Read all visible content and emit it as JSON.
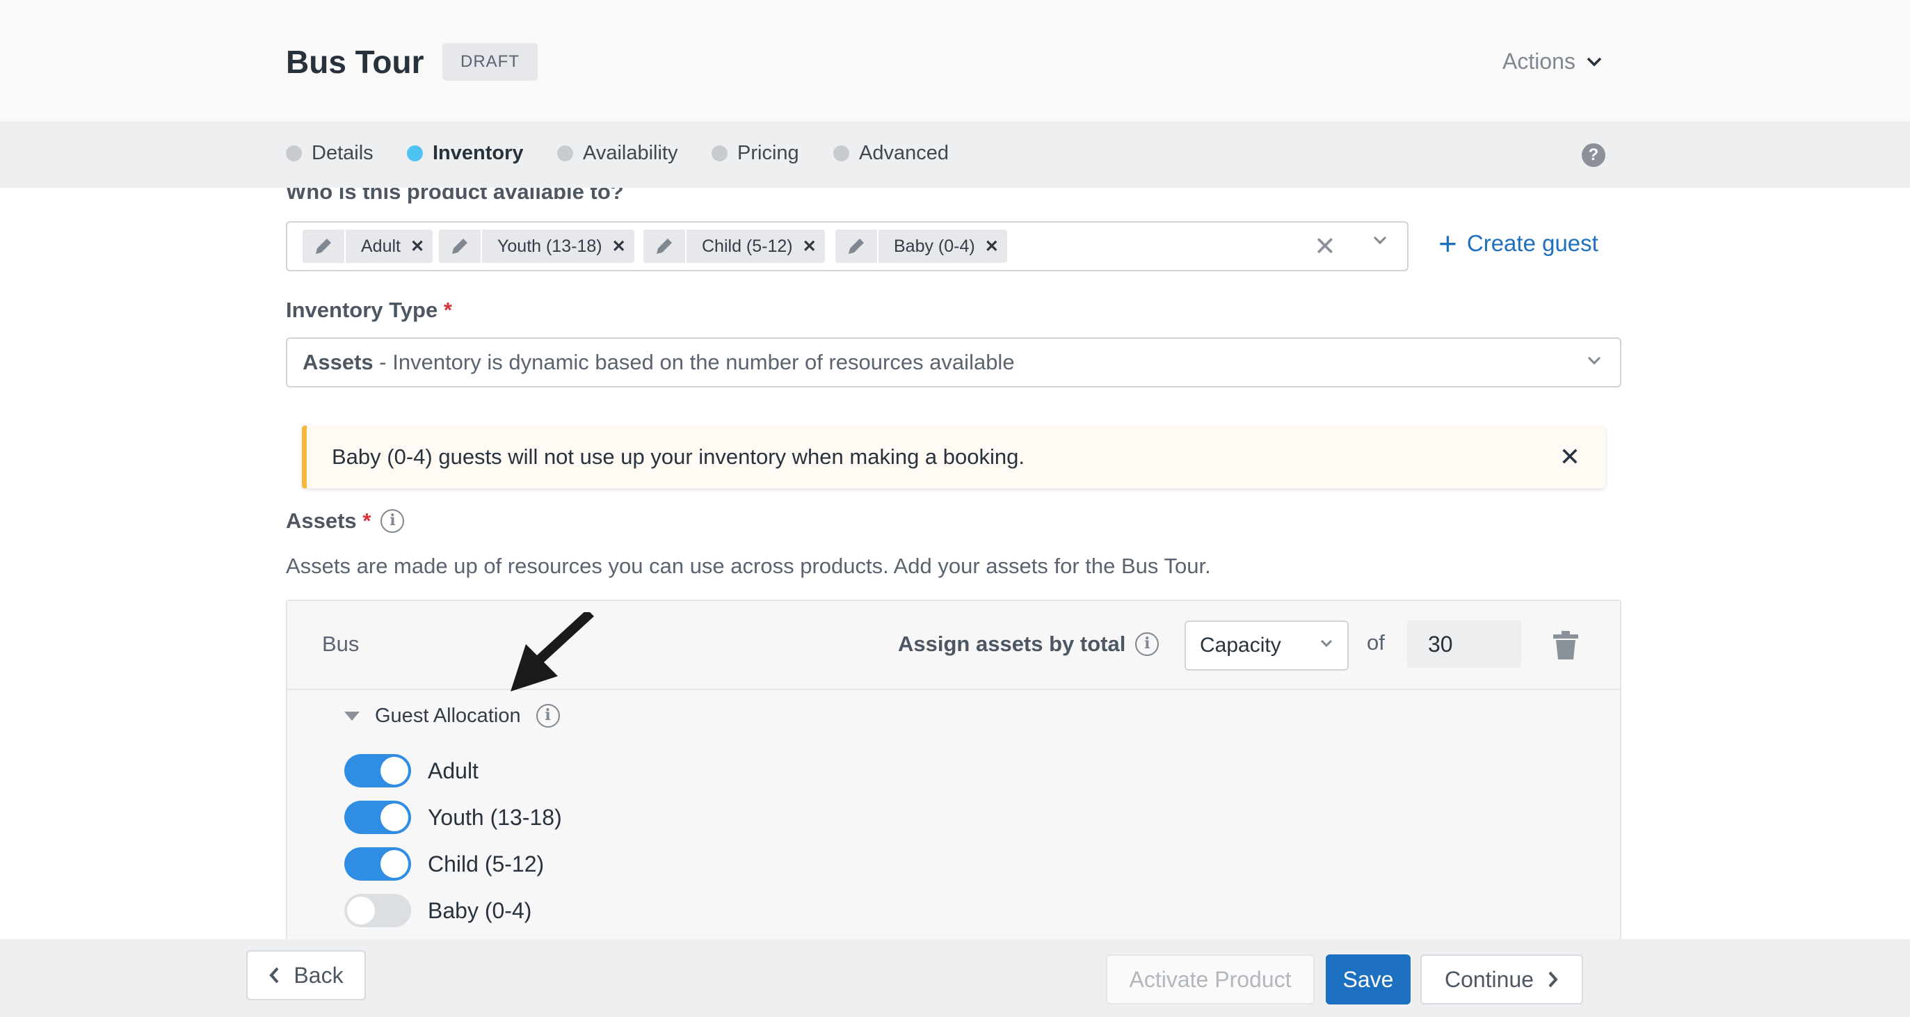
{
  "header": {
    "title": "Bus Tour",
    "status_badge": "DRAFT",
    "actions_label": "Actions"
  },
  "tabs": [
    {
      "label": "Details",
      "active": false
    },
    {
      "label": "Inventory",
      "active": true
    },
    {
      "label": "Availability",
      "active": false
    },
    {
      "label": "Pricing",
      "active": false
    },
    {
      "label": "Advanced",
      "active": false
    }
  ],
  "guests_section": {
    "label": "Who is this product available to?",
    "chips": [
      "Adult",
      "Youth (13-18)",
      "Child (5-12)",
      "Baby (0-4)"
    ],
    "create_guest_label": "Create guest"
  },
  "inventory_type": {
    "label": "Inventory Type",
    "required_mark": "*",
    "selected_name": "Assets",
    "selected_desc": " - Inventory is dynamic based on the number of resources available"
  },
  "alert": {
    "text": "Baby (0-4) guests will not use up your inventory when making a booking."
  },
  "assets": {
    "label": "Assets",
    "required_mark": "*",
    "description": "Assets are made up of resources you can use across products. Add your assets for the Bus Tour.",
    "asset_name": "Bus",
    "assign_label": "Assign assets by total",
    "assign_select_value": "Capacity",
    "of_label": "of",
    "quantity": "30",
    "guest_allocation_label": "Guest Allocation",
    "allocations": [
      {
        "label": "Adult",
        "enabled": true
      },
      {
        "label": "Youth (13-18)",
        "enabled": true
      },
      {
        "label": "Child (5-12)",
        "enabled": true
      },
      {
        "label": "Baby (0-4)",
        "enabled": false
      }
    ]
  },
  "footer": {
    "back_label": "Back",
    "activate_label": "Activate Product",
    "save_label": "Save",
    "continue_label": "Continue"
  },
  "colors": {
    "accent": "#1d6fc0",
    "toggle_on": "#2f8de4",
    "active_tab_dot": "#4dc3f4",
    "alert_border": "#f6b73c",
    "required": "#d9323a"
  },
  "icons": {
    "actions": "chevron-down-icon",
    "help": "question-circle-icon",
    "chip": "pencil-icon",
    "remove": "close-icon",
    "info": "info-circle-icon",
    "delete": "trash-icon",
    "back": "chevron-left-icon",
    "continue": "chevron-right-icon",
    "pointer": "arrow-annotation-icon"
  }
}
